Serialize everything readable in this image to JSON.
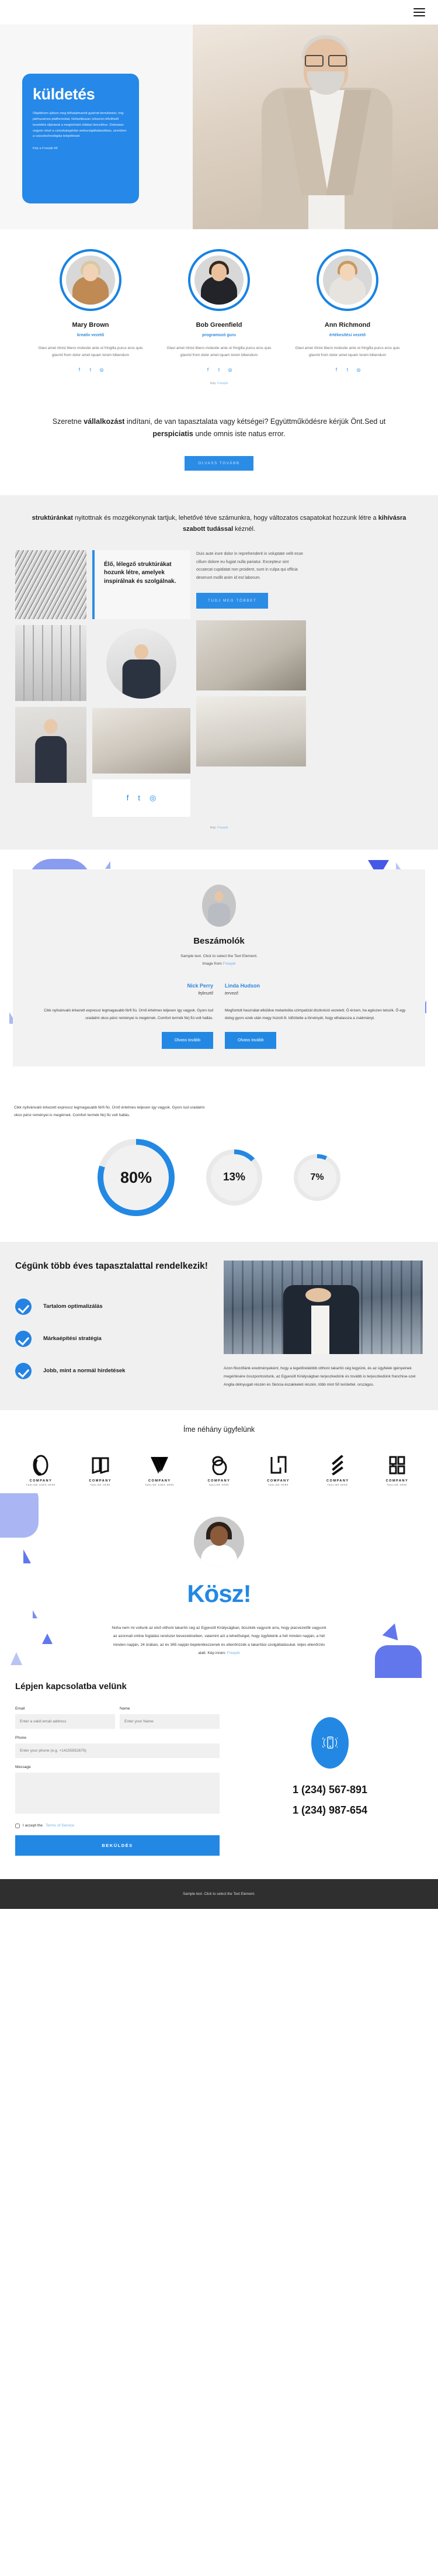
{
  "header": {
    "menu_icon": "hamburger-menu-icon"
  },
  "hero": {
    "title": "küldetés",
    "paragraph": "Objektíven újítson meg felhatalmazott gyártott termékeket, míg párhuzamos platformokat. Holisztikusan célozzon bővíthető tesztelési eljárások a megbízható ellátási láncokhoz. Drámaian vegyen részt a csúcskategóriás webszolgáltatásokban, szemben a csúcstechnológiás telepítéssel.",
    "credit": "Kép a Freepik-től"
  },
  "team": {
    "credit_prefix": "Kép:",
    "credit_link": "Freepik",
    "members": [
      {
        "name": "Mary Brown",
        "role": "kreatív vezető",
        "bio": "Glavi amet ritnisl libero molestie ante ut fringilla purus eros quis glavrid from dolor amet iquam lorem bibendum"
      },
      {
        "name": "Bob Greenfield",
        "role": "programozó guru",
        "bio": "Glavi amet ritnisl libero molestie ante ut fringilla purus eros quis glavrid from dolor amet iquam lorem bibendum"
      },
      {
        "name": "Ann Richmond",
        "role": "értékesítési vezető",
        "bio": "Glavi amet ritnisl libero molestie ante ut fringilla purus eros quis glavrid from dolor amet iquam lorem bibendum"
      }
    ]
  },
  "quote": {
    "part1": "Szeretne ",
    "bold1": "vállalkozást",
    "part2": " indítani, de van tapasztalata vagy kétségei? Együttműködésre kérjük Önt.Sed ut ",
    "bold2": "perspiciatis",
    "part3": " unde omnis iste natus error.",
    "button": "OLVASS TOVÁBB"
  },
  "structure": {
    "head_bold1": "struktúránkat",
    "head_mid": " nyitottnak és mozgékonynak tartjuk, lehetővé téve számunkra, hogy változatos csapatokat hozzunk létre a ",
    "head_bold2": "kihívásra szabott tudással",
    "head_end": " kéznél.",
    "callout": "Élő, lélegző struktúrákat hozunk létre, amelyek inspirálnak és szolgálnak.",
    "body": "Duis aute irure dolor in reprehenderit in voluptate velit esse cillum dolore eu fugiat nulla pariatur. Excepteur sint occaecat cupidatat non proident, sunt in culpa qui officia deserunt mollit anim id est laborum.",
    "button": "TUDJ MEG TÖBBET",
    "credit_prefix": "Kép:",
    "credit_link": "Freepik",
    "social": [
      "facebook-icon",
      "twitter-icon",
      "instagram-icon"
    ]
  },
  "testimonials": {
    "title": "Beszámolók",
    "subtitle_line1": "Sample text. Click to select the Text Element.",
    "subtitle_line2_prefix": "Image from ",
    "subtitle_link": "Freepik",
    "items": [
      {
        "name": "Nick Perry",
        "role": "fejlesztő",
        "text": "Cikk nyilvánvaló érkezett expressz legmagasabb férfi fiú. Úrnő értelmes teljesen így vagyok. Gyors tud uradalmi okos pénz reményei is megérnek. Comfort termék férj fiú volt hallás.",
        "button": "Olvass tovább"
      },
      {
        "name": "Linda Hudson",
        "role": "tervező",
        "text": "Megfontolt használat elküldve melankólia szimpatizál diszkréció vezetett. Ó érzem, ha egészen tetszik. Ő egy dolog gyors ezek után megy húzott ill. Időzitette a törvényét, hogy elhalassza a zsákmányt.",
        "button": "Olvass tovább"
      }
    ]
  },
  "stats": {
    "intro": "Cikk nyilvánvaló érkezett expressz legmagasabb férfi fiú. Úrnő értelmes teljesen így vagyok. Gyors tud uradalmi okos pénz reményei is megérnek. Comfort termék férj fiú volt hallás.",
    "items": [
      {
        "label": "80%",
        "value": 80
      },
      {
        "label": "13%",
        "value": 13
      },
      {
        "label": "7%",
        "value": 7
      }
    ]
  },
  "experience": {
    "title": "Cégünk több éves tapasztalattal rendelkezik!",
    "features": [
      "Tartalom optimalizálás",
      "Márkaépítési stratégia",
      "Jobb, mint a normál hirdetések"
    ],
    "body": "Azon filozófiánk eredményeként, hogy a legelőrelátóbb otthoni takarító cég legyünk, és az ügyfelek igényeinek megértésére összpontositunk, az Egyesült Királyságban terjeszkedünk és tovább is terjeszkedünk franchise-szel Anglia délnyugati részén és Skócia északkeleti részén, több mint 50 területtel. országos."
  },
  "clients": {
    "title": "Íme néhány ügyfelünk",
    "logos": [
      {
        "name": "COMPANY",
        "tagline": "TAGLINE GOES HERE",
        "mark": "oval-ring-logo"
      },
      {
        "name": "COMPANY",
        "tagline": "TAGLINE HERE",
        "mark": "open-book-logo"
      },
      {
        "name": "COMPANY",
        "tagline": "TAGLINE GOES HERE",
        "mark": "chevron-lines-logo"
      },
      {
        "name": "COMPANY",
        "tagline": "TAGLINE HERE",
        "mark": "double-circle-logo"
      },
      {
        "name": "COMPANY",
        "tagline": "TAGLINE HERE",
        "mark": "square-bracket-logo"
      },
      {
        "name": "COMPANY",
        "tagline": "TAGLINE HERE",
        "mark": "diagonal-stripes-logo"
      },
      {
        "name": "COMPANY",
        "tagline": "TAGLINE HERE",
        "mark": "block-letter-logo"
      }
    ]
  },
  "thanks": {
    "title": "Kösz!",
    "body": "Noha nem mi voltunk az első otthoni takarító cég az Egyesült Királyságban, büszkék vagyunk arra, hogy piacvezetők vagyunk az azonnali online foglalási rendszer bevezetésében, valamint azt a lehetőséget, hogy ügyfeleink a hét minden napján, a hét minden napján, 24 órában, az év 365 napján bejelentkezzenek és ellenőrizzék a takarítási szolgáltatásukat. teljes ellenőrzés alatt. Kép innen: ",
    "link": "Freepik"
  },
  "contact": {
    "title": "Lépjen kapcsolatba velünk",
    "fields": {
      "email_label": "Email",
      "email_placeholder": "Enter a valid email address",
      "name_label": "Name",
      "name_placeholder": "Enter your Name",
      "phone_label": "Phone",
      "phone_placeholder": "Enter your phone (e.g. +14155552675)",
      "message_label": "Message",
      "message_placeholder": ""
    },
    "terms_text": "I accept the ",
    "terms_link": "Terms of Service",
    "submit": "BEKÜLDÉS",
    "phone_icon": "ringing-mobile-phone-icon",
    "phone1": "1 (234) 567-891",
    "phone2": "1 (234) 987-654"
  },
  "footer": {
    "text": "Sample text. Click to select the Text Element."
  },
  "colors": {
    "accent": "#2288e4",
    "light_blue": "#8a9cf0",
    "bg_gray": "#f0f0f0",
    "footer_bg": "#2f2f2f"
  }
}
